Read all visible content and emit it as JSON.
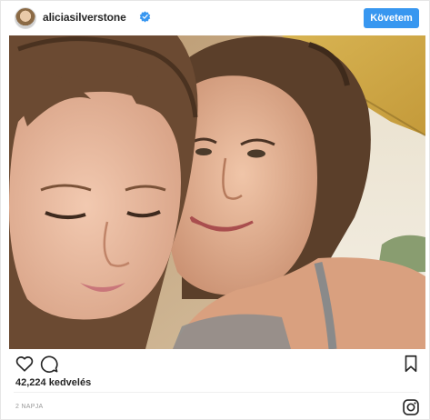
{
  "header": {
    "username": "aliciasilverstone",
    "verified": true,
    "follow_label": "Követem"
  },
  "post": {
    "photo_alt": "Selfie of a woman and a young girl smiling cheek to cheek",
    "likes_count": "42,224",
    "likes_label": "kedvelés",
    "timestamp": "2 NAPJA"
  },
  "icons": {
    "like": "heart-icon",
    "comment": "comment-icon",
    "save": "bookmark-icon",
    "brand": "instagram-icon",
    "verified": "verified-badge-icon"
  },
  "colors": {
    "accent": "#3897f0",
    "text": "#262626",
    "muted": "#999999",
    "border": "#e6e6e6"
  }
}
